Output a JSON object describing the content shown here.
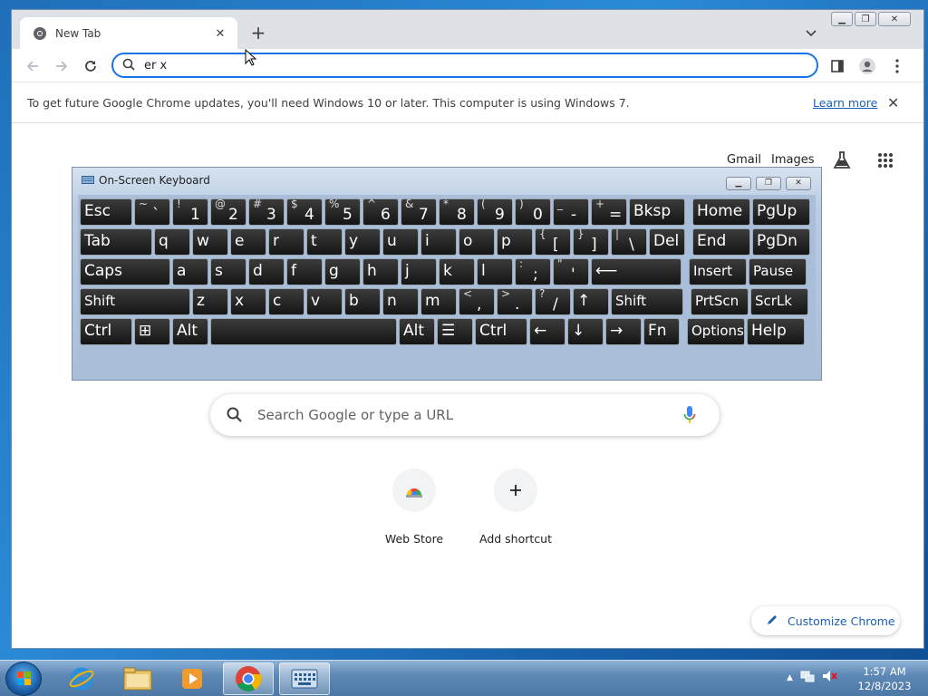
{
  "browser": {
    "tab_title": "New Tab",
    "omnibox_value": "er x",
    "info_bar": {
      "message": "To get future Google Chrome updates, you'll need Windows 10 or later. This computer is using Windows 7.",
      "link": "Learn more"
    }
  },
  "ntp": {
    "links": [
      "Gmail",
      "Images"
    ],
    "search_placeholder": "Search Google or type a URL",
    "shortcuts": [
      {
        "label": "Web Store",
        "icon": "web-store-icon"
      },
      {
        "label": "Add shortcut",
        "icon": "plus-icon"
      }
    ],
    "customize_label": "Customize Chrome"
  },
  "osk": {
    "title": "On-Screen Keyboard",
    "rows": [
      [
        [
          "Esc",
          ""
        ],
        [
          "`",
          "~"
        ],
        [
          "1",
          "!"
        ],
        [
          "2",
          "@"
        ],
        [
          "3",
          "#"
        ],
        [
          "4",
          "$"
        ],
        [
          "5",
          "%"
        ],
        [
          "6",
          "^"
        ],
        [
          "7",
          "&"
        ],
        [
          "8",
          "*"
        ],
        [
          "9",
          "("
        ],
        [
          "0",
          ")"
        ],
        [
          "-",
          "_"
        ],
        [
          "=",
          "+"
        ],
        [
          "Bksp",
          ""
        ],
        [
          "Home",
          ""
        ],
        [
          "PgUp",
          ""
        ]
      ],
      [
        [
          "Tab",
          ""
        ],
        [
          "q",
          ""
        ],
        [
          "w",
          ""
        ],
        [
          "e",
          ""
        ],
        [
          "r",
          ""
        ],
        [
          "t",
          ""
        ],
        [
          "y",
          ""
        ],
        [
          "u",
          ""
        ],
        [
          "i",
          ""
        ],
        [
          "o",
          ""
        ],
        [
          "p",
          ""
        ],
        [
          "[",
          "{"
        ],
        [
          "]",
          "}"
        ],
        [
          "\\",
          "|"
        ],
        [
          "Del",
          ""
        ],
        [
          "End",
          ""
        ],
        [
          "PgDn",
          ""
        ]
      ],
      [
        [
          "Caps",
          ""
        ],
        [
          "a",
          ""
        ],
        [
          "s",
          ""
        ],
        [
          "d",
          ""
        ],
        [
          "f",
          ""
        ],
        [
          "g",
          ""
        ],
        [
          "h",
          ""
        ],
        [
          "j",
          ""
        ],
        [
          "k",
          ""
        ],
        [
          "l",
          ""
        ],
        [
          ";",
          ":"
        ],
        [
          "'",
          "\""
        ],
        [
          "⟵",
          ""
        ],
        [
          "Insert",
          ""
        ],
        [
          "Pause",
          ""
        ]
      ],
      [
        [
          "Shift",
          ""
        ],
        [
          "z",
          ""
        ],
        [
          "x",
          ""
        ],
        [
          "c",
          ""
        ],
        [
          "v",
          ""
        ],
        [
          "b",
          ""
        ],
        [
          "n",
          ""
        ],
        [
          "m",
          ""
        ],
        [
          ",",
          "<"
        ],
        [
          ".",
          ">"
        ],
        [
          "/",
          "?"
        ],
        [
          "↑",
          ""
        ],
        [
          "Shift",
          ""
        ],
        [
          "PrtScn",
          ""
        ],
        [
          "ScrLk",
          ""
        ]
      ],
      [
        [
          "Ctrl",
          ""
        ],
        [
          "⊞",
          ""
        ],
        [
          "Alt",
          ""
        ],
        [
          "",
          ""
        ],
        [
          "Alt",
          ""
        ],
        [
          "☰",
          ""
        ],
        [
          "Ctrl",
          ""
        ],
        [
          "←",
          ""
        ],
        [
          "↓",
          ""
        ],
        [
          "→",
          ""
        ],
        [
          "Fn",
          ""
        ],
        [
          "Options",
          ""
        ],
        [
          "Help",
          ""
        ]
      ]
    ]
  },
  "taskbar": {
    "time": "1:57 AM",
    "date": "12/8/2023",
    "apps": [
      "internet-explorer-icon",
      "file-explorer-icon",
      "media-player-icon",
      "chrome-icon",
      "on-screen-keyboard-icon"
    ]
  },
  "colors": {
    "accent": "#1a73e8",
    "link": "#1a5fb4"
  }
}
